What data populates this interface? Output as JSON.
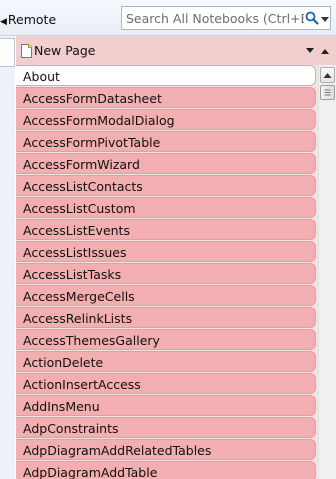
{
  "toolbar": {
    "remote_label": "Remote",
    "search": {
      "placeholder": "Search All Notebooks (Ctrl+E)"
    }
  },
  "icons": {
    "remote_arrow": "chevron-left-icon",
    "search": "search-icon",
    "search_dropdown": "chevron-down-icon",
    "new_page": "page-icon",
    "panel_dropdown": "chevron-down-icon",
    "panel_scroll": "scroll-up-icon"
  },
  "panel": {
    "new_page_label": "New Page",
    "pages": [
      {
        "label": "About",
        "selected": true
      },
      {
        "label": "AccessFormDatasheet"
      },
      {
        "label": "AccessFormModalDialog"
      },
      {
        "label": "AccessFormPivotTable"
      },
      {
        "label": "AccessFormWizard"
      },
      {
        "label": "AccessListContacts"
      },
      {
        "label": "AccessListCustom"
      },
      {
        "label": "AccessListEvents"
      },
      {
        "label": "AccessListIssues"
      },
      {
        "label": "AccessListTasks"
      },
      {
        "label": "AccessMergeCells"
      },
      {
        "label": "AccessRelinkLists"
      },
      {
        "label": "AccessThemesGallery"
      },
      {
        "label": "ActionDelete"
      },
      {
        "label": "ActionInsertAccess"
      },
      {
        "label": "AddInsMenu"
      },
      {
        "label": "AdpConstraints"
      },
      {
        "label": "AdpDiagramAddRelatedTables"
      },
      {
        "label": "AdpDiagramAddTable"
      }
    ]
  },
  "colors": {
    "section_color": "#f2aeb1",
    "section_border": "#e39da2",
    "panel_header": "#f3cece",
    "selected_page": "#ffffff"
  }
}
